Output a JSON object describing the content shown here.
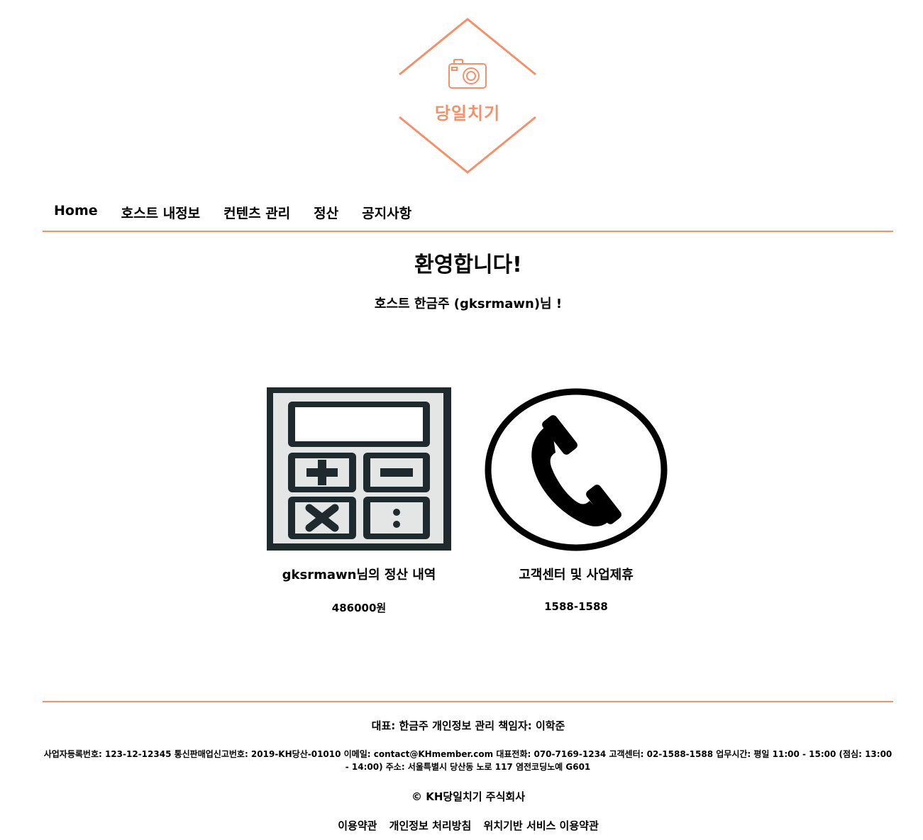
{
  "brand": {
    "logo_text": "당일치기",
    "accent_color": "#f4906a",
    "logo_icon": "camera-icon"
  },
  "nav": {
    "items": [
      {
        "label": "Home"
      },
      {
        "label": "호스트 내정보"
      },
      {
        "label": "컨텐츠 관리"
      },
      {
        "label": "정산"
      },
      {
        "label": "공지사항"
      }
    ]
  },
  "welcome": {
    "title": "환영합니다!",
    "subtitle": "호스트 한금주 (gksrmawn)님 !"
  },
  "cards": [
    {
      "icon": "calculator-icon",
      "title": "gksrmawn님의 정산 내역",
      "value": "486000원"
    },
    {
      "icon": "phone-icon",
      "title": "고객센터 및 사업제휴",
      "value": "1588-1588"
    }
  ],
  "footer": {
    "representative": "대표: 한금주 개인정보 관리 책임자: 이학준",
    "info": "사업자등록번호: 123-12-12345 통신판매업신고번호: 2019-KH당산-01010 이메일: contact@KHmember.com 대표전화: 070-7169-1234 고객센터: 02-1588-1588 업무시간: 평일 11:00 - 15:00 (점심: 13:00 - 14:00) 주소: 서울특별시 당산동 노로 117 염전코딩노예 G601",
    "copyright": "© KH당일치기 주식회사",
    "links": [
      {
        "label": "이용약관"
      },
      {
        "label": "개인정보 처리방침"
      },
      {
        "label": "위치기반 서비스 이용약관"
      }
    ]
  }
}
